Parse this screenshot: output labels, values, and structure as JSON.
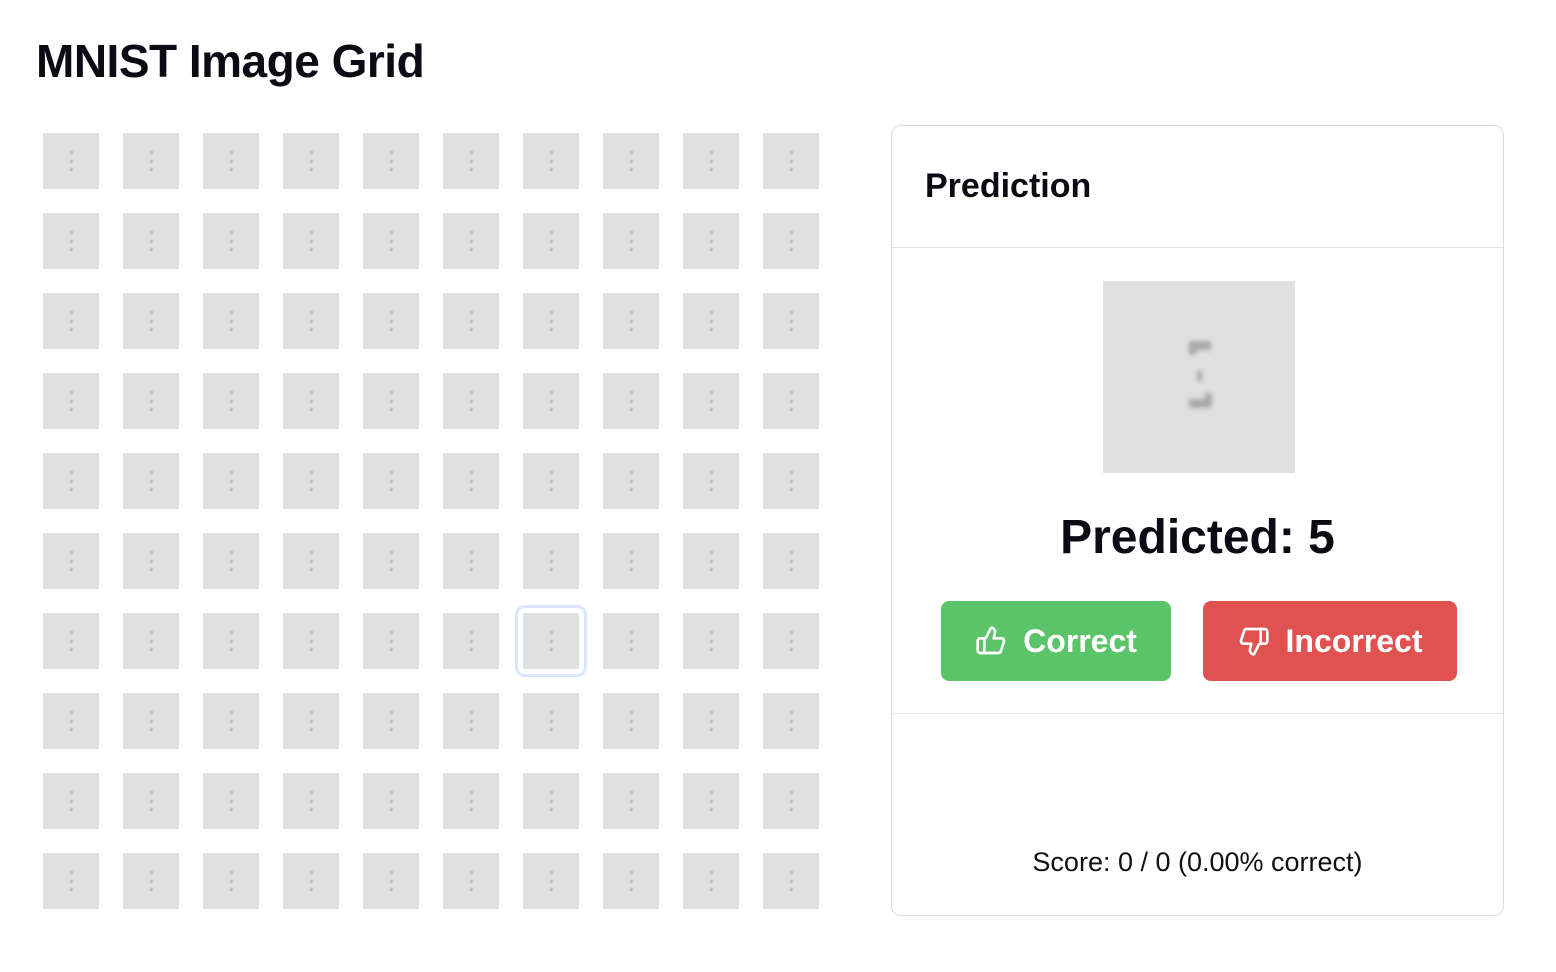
{
  "page": {
    "title": "MNIST Image Grid"
  },
  "grid": {
    "rows": 10,
    "cols": 10,
    "selected_row": 6,
    "selected_col": 6
  },
  "panel": {
    "title": "Prediction",
    "predicted_text": "Predicted: 5",
    "correct_label": "Correct",
    "incorrect_label": "Incorrect",
    "correct_icon": "thumbs-up-icon",
    "incorrect_icon": "thumbs-down-icon",
    "score_text": "Score: 0 / 0 (0.00% correct)"
  },
  "colors": {
    "correct": "#5cc468",
    "incorrect": "#e0524f",
    "cell_bg": "#e0e0e0",
    "selection": "#dbe6fb"
  }
}
